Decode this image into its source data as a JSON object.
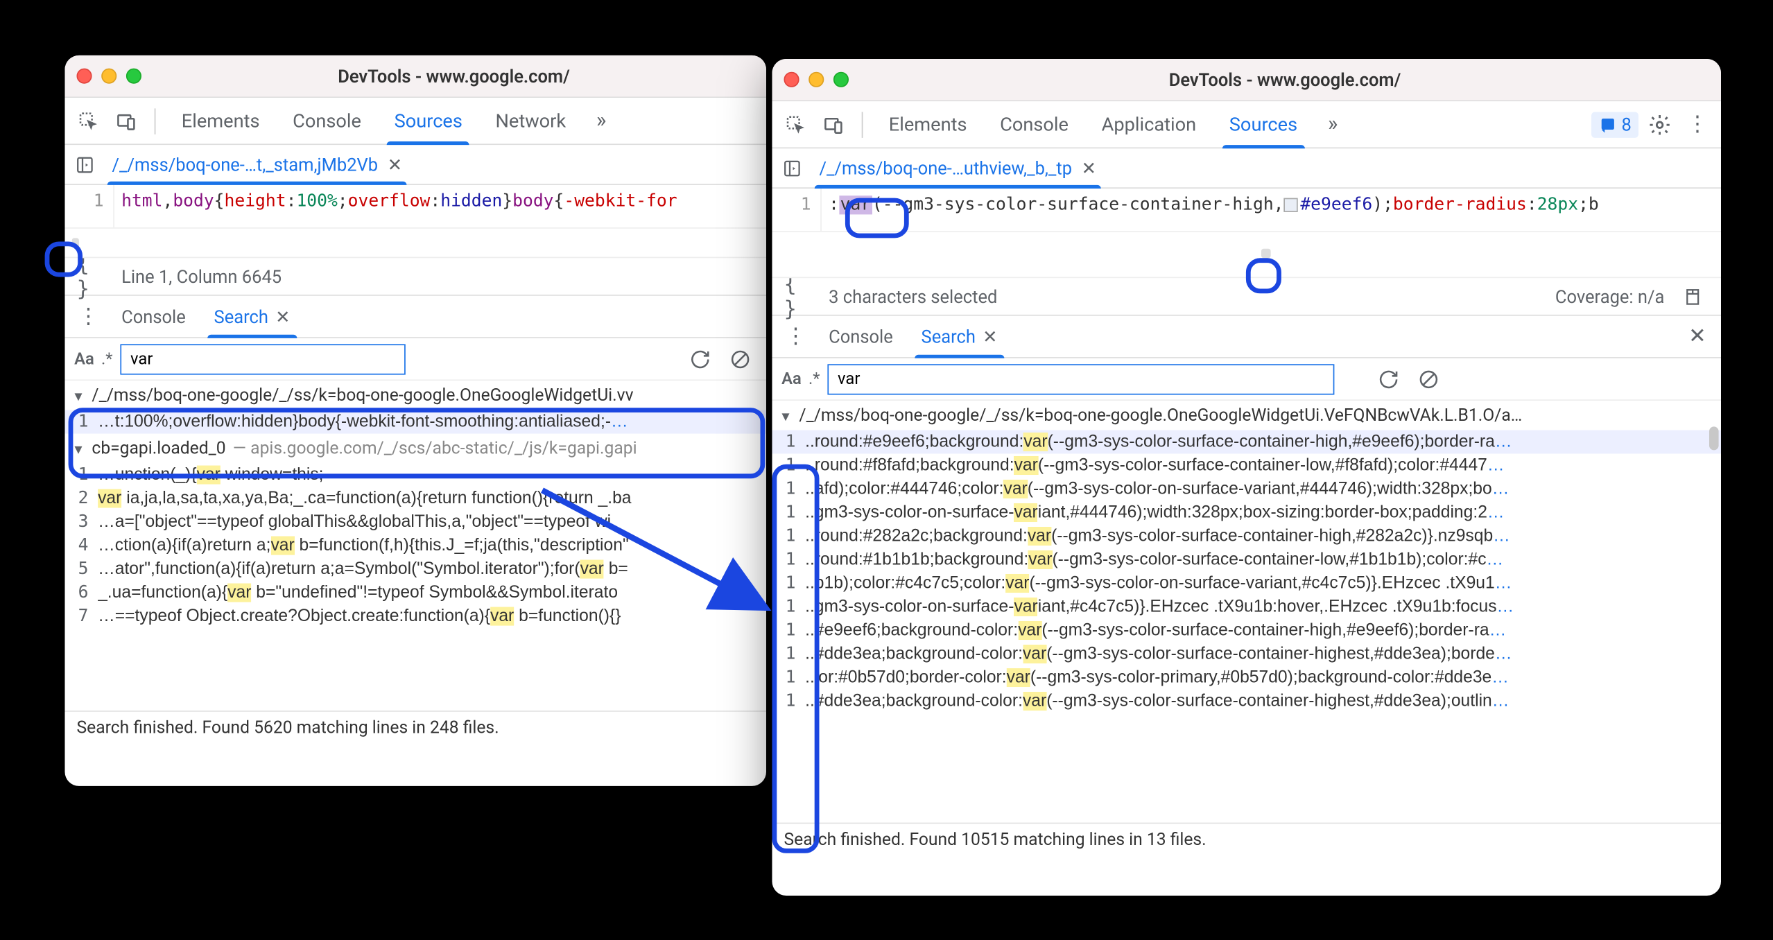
{
  "left": {
    "title": "DevTools - www.google.com/",
    "tabs": [
      "Elements",
      "Console",
      "Sources",
      "Network"
    ],
    "active_tab": "Sources",
    "more": "»",
    "file_tab": "/_/mss/boq-one-…t,_stam,jMb2Vb",
    "code_gutter": "1",
    "code_html": "<span class='tok-tag'>html</span>,<span class='tok-tag'>body</span>{<span class='tok-prop'>height</span>:<span class='tok-num'>100%</span>;<span class='tok-prop'>overflow</span>:<span class='tok-val'>hidden</span>}<span class='tok-tag'>body</span>{<span class='tok-prop'>-webkit-for</span>",
    "status_line": "Line 1, Column 6645",
    "drawer_tabs": [
      "Console",
      "Search"
    ],
    "drawer_active": "Search",
    "search_value": "var",
    "results": {
      "files": [
        {
          "path": "/_/mss/boq-one-google/_/ss/k=boq-one-google.OneGoogleWidgetUi.vv",
          "lines": [
            {
              "n": "1",
              "pre": "…t:100%;overflow:hidden}body{-webkit-font-smoothing:antialiased;-",
              "hl": "",
              "post": "",
              "selected": true,
              "ell": true
            }
          ]
        },
        {
          "path": "cb=gapi.loaded_0",
          "dim": " — apis.google.com/_/scs/abc-static/_/js/k=gapi.gapi",
          "lines": [
            {
              "n": "1",
              "pre": "…unction(_){",
              "hl": "var",
              "post": " window=this;"
            },
            {
              "n": "2",
              "pre": "",
              "hl": "var",
              "post": " ia,ja,la,sa,ta,xa,ya,Ba;_.ca=function(a){return function(){return _.ba"
            },
            {
              "n": "3",
              "pre": "…a=[\"object\"==typeof globalThis&&globalThis,a,\"object\"==typeof wi",
              "hl": "",
              "post": ""
            },
            {
              "n": "4",
              "pre": "…ction(a){if(a)return a;",
              "hl": "var",
              "post": " b=function(f,h){this.J_=f;ja(this,\"description\""
            },
            {
              "n": "5",
              "pre": "…ator\",function(a){if(a)return a;a=Symbol(\"Symbol.iterator\");for(",
              "hl": "var",
              "post": " b="
            },
            {
              "n": "6",
              "pre": "_.ua=function(a){",
              "hl": "var",
              "post": " b=\"undefined\"!=typeof Symbol&&Symbol.iterato"
            },
            {
              "n": "7",
              "pre": "…==typeof Object.create?Object.create:function(a){",
              "hl": "var",
              "post": " b=function(){}"
            }
          ]
        }
      ]
    },
    "footer": "Search finished.  Found 5620 matching lines in 248 files."
  },
  "right": {
    "title": "DevTools - www.google.com/",
    "tabs": [
      "Elements",
      "Console",
      "Application",
      "Sources"
    ],
    "active_tab": "Sources",
    "more": "»",
    "badge_count": "8",
    "file_tab": "/_/mss/boq-one-…uthview,_b,_tp",
    "code_gutter": "1",
    "code_html": ":<span class='selection-box'>var</span>(--gm3-sys-color-surface-container-high,<span class='tok-swatch'></span><span class='tok-val'>#e9eef6</span>);<span class='tok-prop'>border-radius</span>:<span class='tok-num'>28px</span>;b",
    "status_line": "3 characters selected",
    "coverage": "Coverage: n/a",
    "drawer_tabs": [
      "Console",
      "Search"
    ],
    "drawer_active": "Search",
    "search_value": "var",
    "results": {
      "file_header": "/_/mss/boq-one-google/_/ss/k=boq-one-google.OneGoogleWidgetUi.VeFQNBcwVAk.L.B1.O/a…",
      "lines": [
        {
          "n": "1",
          "pre": "..round:#e9eef6;background:",
          "hl": "var",
          "post": "(--gm3-sys-color-surface-container-high,#e9eef6);border-ra",
          "selected": true,
          "ell": true
        },
        {
          "n": "1",
          "pre": "..round:#f8fafd;background:",
          "hl": "var",
          "post": "(--gm3-sys-color-surface-container-low,#f8fafd);color:#4447",
          "ell": true
        },
        {
          "n": "1",
          "pre": "..afd);color:#444746;color:",
          "hl": "var",
          "post": "(--gm3-sys-color-on-surface-variant,#444746);width:328px;bo",
          "ell": true
        },
        {
          "n": "1",
          "pre": "..gm3-sys-color-on-surface-",
          "hl": "var",
          "post": "iant,#444746);width:328px;box-sizing:border-box;padding:2",
          "ell": true
        },
        {
          "n": "1",
          "pre": "..round:#282a2c;background:",
          "hl": "var",
          "post": "(--gm3-sys-color-surface-container-high,#282a2c)}.nz9sqb",
          "ell": true
        },
        {
          "n": "1",
          "pre": "..round:#1b1b1b;background:",
          "hl": "var",
          "post": "(--gm3-sys-color-surface-container-low,#1b1b1b);color:#c",
          "ell": true
        },
        {
          "n": "1",
          "pre": "..b1b);color:#c4c7c5;color:",
          "hl": "var",
          "post": "(--gm3-sys-color-on-surface-variant,#c4c7c5)}.EHzcec .tX9u1",
          "ell": true
        },
        {
          "n": "1",
          "pre": "..gm3-sys-color-on-surface-",
          "hl": "var",
          "post": "iant,#c4c7c5)}.EHzcec .tX9u1b:hover,.EHzcec .tX9u1b:focus",
          "ell": true
        },
        {
          "n": "1",
          "pre": "..#e9eef6;background-color:",
          "hl": "var",
          "post": "(--gm3-sys-color-surface-container-high,#e9eef6);border-ra",
          "ell": true
        },
        {
          "n": "1",
          "pre": "..#dde3ea;background-color:",
          "hl": "var",
          "post": "(--gm3-sys-color-surface-container-highest,#dde3ea);borde",
          "ell": true
        },
        {
          "n": "1",
          "pre": "..lor:#0b57d0;border-color:",
          "hl": "var",
          "post": "(--gm3-sys-color-primary,#0b57d0);background-color:#dde3e",
          "ell": true
        },
        {
          "n": "1",
          "pre": "..#dde3ea;background-color:",
          "hl": "var",
          "post": "(--gm3-sys-color-surface-container-highest,#dde3ea);outlin",
          "ell": true
        }
      ]
    },
    "footer": "Search finished.  Found 10515 matching lines in 13 files."
  }
}
